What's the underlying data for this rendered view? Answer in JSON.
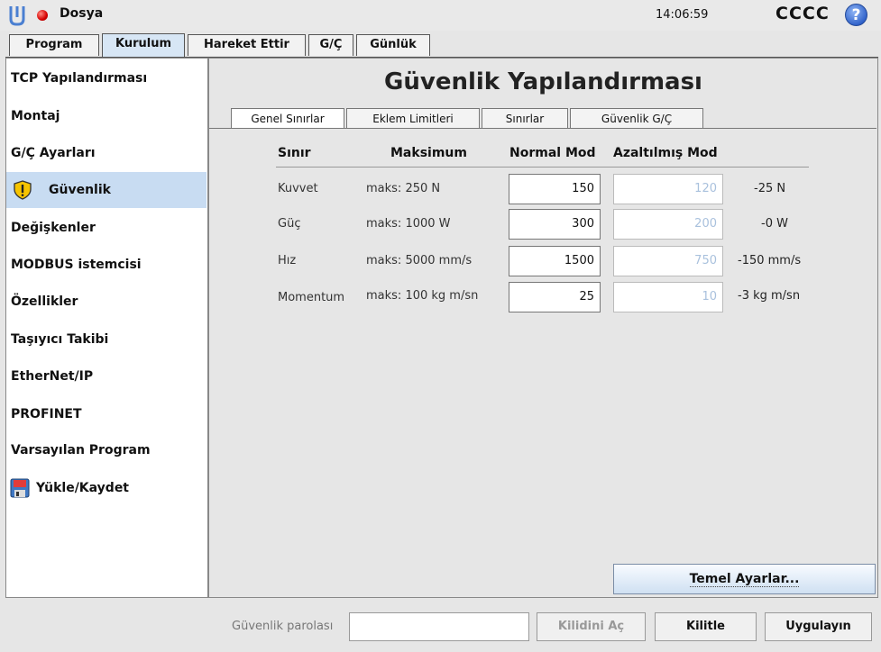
{
  "topbar": {
    "file_menu": "Dosya",
    "clock": "14:06:59",
    "robot_name": "CCCC",
    "help_glyph": "?"
  },
  "main_tabs": [
    "Program",
    "Kurulum",
    "Hareket Ettir",
    "G/Ç",
    "Günlük"
  ],
  "sidebar": {
    "items": [
      {
        "label": "TCP Yapılandırması"
      },
      {
        "label": "Montaj"
      },
      {
        "label": "G/Ç Ayarları"
      },
      {
        "label": "Güvenlik",
        "selected": true,
        "icon": "shield-warning-icon"
      },
      {
        "label": "Değişkenler"
      },
      {
        "label": "MODBUS istemcisi"
      },
      {
        "label": "Özellikler"
      },
      {
        "label": "Taşıyıcı Takibi"
      },
      {
        "label": "EtherNet/IP"
      },
      {
        "label": "PROFINET"
      },
      {
        "label": "Varsayılan Program"
      },
      {
        "label": "Yükle/Kaydet",
        "icon": "floppy-disk-icon"
      }
    ]
  },
  "content": {
    "title": "Güvenlik Yapılandırması",
    "sub_tabs": [
      "Genel Sınırlar",
      "Eklem Limitleri",
      "Sınırlar",
      "Güvenlik G/Ç"
    ],
    "headers": {
      "limit": "Sınır",
      "maximum": "Maksimum",
      "normal": "Normal Mod",
      "reduced": "Azaltılmış Mod"
    },
    "rows": [
      {
        "label": "Kuvvet",
        "max": "maks: 250 N",
        "normal": "150",
        "reduced": "120",
        "delta": "-25 N"
      },
      {
        "label": "Güç",
        "max": "maks: 1000 W",
        "normal": "300",
        "reduced": "200",
        "delta": "-0 W"
      },
      {
        "label": "Hız",
        "max": "maks: 5000 mm/s",
        "normal": "1500",
        "reduced": "750",
        "delta": "-150 mm/s"
      },
      {
        "label": "Momentum",
        "max": "maks: 100 kg m/sn",
        "normal": "25",
        "reduced": "10",
        "delta": "-3 kg m/sn"
      }
    ],
    "basic_settings_button": "Temel Ayarlar..."
  },
  "bottom": {
    "password_label": "Güvenlik parolası",
    "password_value": "",
    "unlock_button": "Kilidini Aç",
    "lock_button": "Kilitle",
    "apply_button": "Uygulayın"
  },
  "colors": {
    "selection": "#c8dcf2",
    "status_dot": "#d50000",
    "help": "#2d5fc8"
  }
}
